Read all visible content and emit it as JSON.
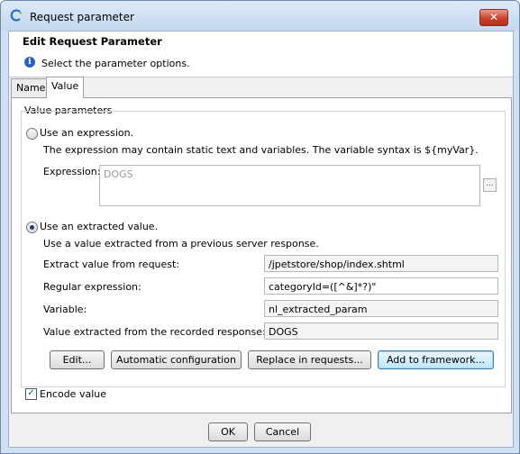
{
  "window": {
    "title": "Request parameter",
    "close_glyph": "✕"
  },
  "header": {
    "title": "Edit Request Parameter",
    "description": "Select the parameter options."
  },
  "tabs": [
    {
      "label": "Name",
      "active": false
    },
    {
      "label": "Value",
      "active": true
    }
  ],
  "value_parameters": {
    "group_title": "Value parameters",
    "expression_option": {
      "label": "Use an expression.",
      "selected": false,
      "hint": "The expression may contain static text and variables. The variable syntax is ${myVar}.",
      "field_label": "Expression:",
      "field_value": "DOGS",
      "browse_label": "..."
    },
    "extracted_option": {
      "label": "Use an extracted value.",
      "selected": true,
      "hint": "Use a value extracted from a previous server response.",
      "fields": [
        {
          "label": "Extract value from request:",
          "value": "/jpetstore/shop/index.shtml"
        },
        {
          "label": "Regular expression:",
          "value": "categoryId=([^&]*?)\""
        },
        {
          "label": "Variable:",
          "value": "nl_extracted_param"
        },
        {
          "label": "Value extracted from the recorded response:",
          "value": "DOGS"
        }
      ]
    },
    "buttons": {
      "edit": "Edit...",
      "auto_config": "Automatic configuration",
      "replace": "Replace in requests...",
      "add_framework": "Add to framework..."
    }
  },
  "encode_value": {
    "label": "Encode value",
    "checked": true,
    "mark": "✓"
  },
  "footer": {
    "ok": "OK",
    "cancel": "Cancel"
  }
}
